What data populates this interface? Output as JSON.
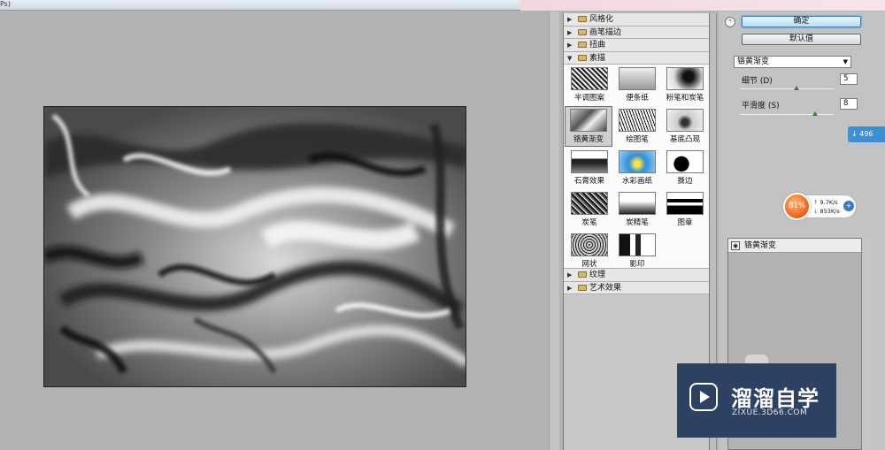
{
  "window": {
    "title_fragment": "Ps)"
  },
  "gallery": {
    "categories_top": [
      "风格化",
      "画笔描边",
      "扭曲"
    ],
    "open_category": "素描",
    "filters": [
      {
        "label": "半调图案",
        "selected": false
      },
      {
        "label": "便条纸",
        "selected": false
      },
      {
        "label": "粉笔和炭笔",
        "selected": false
      },
      {
        "label": "铬黄渐变",
        "selected": true
      },
      {
        "label": "绘图笔",
        "selected": false
      },
      {
        "label": "基底凸现",
        "selected": false
      },
      {
        "label": "石膏效果",
        "selected": false
      },
      {
        "label": "水彩画纸",
        "selected": false
      },
      {
        "label": "撕边",
        "selected": false
      },
      {
        "label": "炭笔",
        "selected": false
      },
      {
        "label": "炭精笔",
        "selected": false
      },
      {
        "label": "图章",
        "selected": false
      },
      {
        "label": "网状",
        "selected": false
      },
      {
        "label": "影印",
        "selected": false
      }
    ],
    "categories_bottom": [
      "纹理",
      "艺术效果"
    ]
  },
  "settings": {
    "collapse_symbol": "⌃",
    "ok_label": "确定",
    "default_label": "默认值",
    "filter_select": "铬黄渐变",
    "params": [
      {
        "label": "细节 (D)",
        "value": "5",
        "fraction": 0.6
      },
      {
        "label": "平滑度 (S)",
        "value": "8",
        "fraction": 0.8
      }
    ],
    "layer_name": "铬黄渐变"
  },
  "network": {
    "percent": "81%",
    "up": "9.7K/s",
    "down": "853K/s",
    "badge": "↓ 496"
  },
  "watermark": {
    "title": "溜溜自学",
    "subtitle": "ZIXUE.3D66.COM"
  }
}
